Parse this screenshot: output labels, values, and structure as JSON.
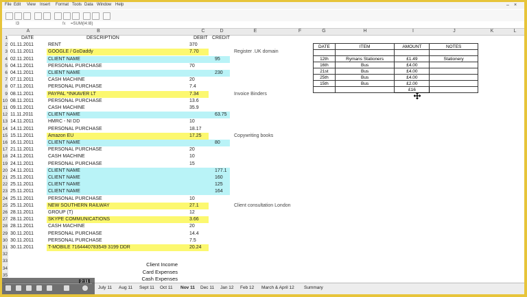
{
  "menu": [
    "File",
    "Edit",
    "View",
    "Insert",
    "Format",
    "Tools",
    "Data",
    "Window",
    "Help"
  ],
  "formula": {
    "namebox": "I3",
    "content": "=SUM(I4:I8)"
  },
  "columns": [
    "A",
    "B",
    "C",
    "D",
    "E",
    "F",
    "G",
    "H",
    "I",
    "J",
    "K",
    "L"
  ],
  "headers": {
    "date": "DATE",
    "desc": "DESCRIPTION",
    "debit": "DEBIT",
    "credit": "CREDIT"
  },
  "rows": [
    {
      "n": "2",
      "date": "01.11.2011",
      "desc": "RENT",
      "debit": "370",
      "credit": "",
      "hl": ""
    },
    {
      "n": "3",
      "date": "01.11.2011",
      "desc": "GOOGLE / GoDaddy",
      "debit": "7.70",
      "credit": "",
      "hl": "yel",
      "note": "Register .UK domain"
    },
    {
      "n": "4",
      "date": "02.11.2011",
      "desc": "CLIENT NAME",
      "debit": "",
      "credit": "95",
      "hl": "cyn"
    },
    {
      "n": "5",
      "date": "04.11.2011",
      "desc": "PERSONAL PURCHASE",
      "debit": "70",
      "credit": "",
      "hl": ""
    },
    {
      "n": "6",
      "date": "04.11.2011",
      "desc": "CLIENT NAME",
      "debit": "",
      "credit": "230",
      "hl": "cyn"
    },
    {
      "n": "7",
      "date": "07.11.2011",
      "desc": "CASH MACHINE",
      "debit": "20",
      "credit": "",
      "hl": ""
    },
    {
      "n": "8",
      "date": "07.11.2011",
      "desc": "PERSONAL PURCHASE",
      "debit": "7.4",
      "credit": "",
      "hl": ""
    },
    {
      "n": "9",
      "date": "08.11.2011",
      "desc": "PAYPAL *INKAVER LT",
      "debit": "7.34",
      "credit": "",
      "hl": "yel",
      "note": "Invoice Binders"
    },
    {
      "n": "10",
      "date": "08.11.2011",
      "desc": "PERSONAL PURCHASE",
      "debit": "13.6",
      "credit": "",
      "hl": ""
    },
    {
      "n": "11",
      "date": "09.11.2011",
      "desc": "CASH MACHINE",
      "debit": "35.9",
      "credit": "",
      "hl": ""
    },
    {
      "n": "12",
      "date": "11.11.2011",
      "desc": "CLIENT NAME",
      "debit": "",
      "credit": "63.75",
      "hl": "cyn"
    },
    {
      "n": "13",
      "date": "14.11.2011",
      "desc": "HMRC - NI DD",
      "debit": "10",
      "credit": "",
      "hl": ""
    },
    {
      "n": "14",
      "date": "14.11.2011",
      "desc": "PERSONAL PURCHASE",
      "debit": "18.17",
      "credit": "",
      "hl": ""
    },
    {
      "n": "15",
      "date": "15.11.2011",
      "desc": "Amazon EU",
      "debit": "17.25",
      "credit": "",
      "hl": "yel",
      "note": "Copywriting books"
    },
    {
      "n": "16",
      "date": "16.11.2011",
      "desc": "CLIENT NAME",
      "debit": "",
      "credit": "80",
      "hl": "cyn"
    },
    {
      "n": "17",
      "date": "21.11.2011",
      "desc": "PERSONAL PURCHASE",
      "debit": "20",
      "credit": "",
      "hl": ""
    },
    {
      "n": "18",
      "date": "24.11.2011",
      "desc": "CASH MACHINE",
      "debit": "10",
      "credit": "",
      "hl": ""
    },
    {
      "n": "19",
      "date": "24.11.2011",
      "desc": "PERSONAL PURCHASE",
      "debit": "15",
      "credit": "",
      "hl": ""
    },
    {
      "n": "20",
      "date": "24.11.2011",
      "desc": "CLIENT NAME",
      "debit": "",
      "credit": "177.1",
      "hl": "cyn"
    },
    {
      "n": "21",
      "date": "25.11.2011",
      "desc": "CLIENT NAME",
      "debit": "",
      "credit": "160",
      "hl": "cyn"
    },
    {
      "n": "22",
      "date": "25.11.2011",
      "desc": "CLIENT NAME",
      "debit": "",
      "credit": "125",
      "hl": "cyn"
    },
    {
      "n": "23",
      "date": "25.11.2011",
      "desc": "CLIENT NAME",
      "debit": "",
      "credit": "164",
      "hl": "cyn"
    },
    {
      "n": "24",
      "date": "25.11.2011",
      "desc": "PERSONAL PURCHASE",
      "debit": "10",
      "credit": "",
      "hl": ""
    },
    {
      "n": "25",
      "date": "25.11.2011",
      "desc": "NEW SOUTHERN RAILWAY",
      "debit": "27.1",
      "credit": "",
      "hl": "yel",
      "note": "Client consultation London"
    },
    {
      "n": "26",
      "date": "28.11.2011",
      "desc": "GROUP (T)",
      "debit": "12",
      "credit": "",
      "hl": ""
    },
    {
      "n": "27",
      "date": "28.11.2011",
      "desc": "SKYPE COMMUNICATIONS",
      "debit": "3.66",
      "credit": "",
      "hl": "yel"
    },
    {
      "n": "28",
      "date": "28.11.2011",
      "desc": "CASH MACHINE",
      "debit": "20",
      "credit": "",
      "hl": ""
    },
    {
      "n": "29",
      "date": "30.11.2011",
      "desc": "PERSONAL PURCHASE",
      "debit": "14.4",
      "credit": "",
      "hl": ""
    },
    {
      "n": "30",
      "date": "30.11.2011",
      "desc": "PERSONAL PURCHASE",
      "debit": "7.5",
      "credit": "",
      "hl": ""
    },
    {
      "n": "31",
      "date": "30.11.2011",
      "desc": "T-MOBILE      7164440783549 3199 DDR",
      "debit": "20.24",
      "credit": "",
      "hl": "yel"
    },
    {
      "n": "32",
      "date": "",
      "desc": "",
      "debit": "",
      "credit": "",
      "hl": ""
    },
    {
      "n": "33",
      "date": "",
      "desc": "",
      "debit": "",
      "credit": "",
      "hl": ""
    },
    {
      "n": "34",
      "date": "",
      "desc": "",
      "debit": "",
      "credit": "",
      "hl": ""
    },
    {
      "n": "35",
      "date": "",
      "desc": "",
      "debit": "",
      "credit": "",
      "hl": ""
    }
  ],
  "lookup": {
    "headers": [
      "DATE",
      "ITEM",
      "AMOUNT",
      "NOTES"
    ],
    "rows": [
      [
        "",
        "",
        "",
        ""
      ],
      [
        "12th",
        "Rymans Stationers",
        "£1.49",
        "Stationery"
      ],
      [
        "16th",
        "Bus",
        "£4.00",
        ""
      ],
      [
        "21st",
        "Bus",
        "£4.00",
        ""
      ],
      [
        "25th",
        "Bus",
        "£4.00",
        ""
      ],
      [
        "15th",
        "Bus",
        "£2.00",
        ""
      ],
      [
        "",
        "",
        "£16",
        ""
      ]
    ]
  },
  "summary": [
    "Client Income",
    "Card Expenses",
    "Cash Expenses"
  ],
  "tabs": [
    "July 11",
    "Aug 11",
    "Sept 11",
    "Oct 11",
    "Nov 11",
    "Dec 11",
    "Jan 12",
    "Feb 12",
    "March & April 12",
    "Summary"
  ],
  "active_tab": "Nov 11",
  "video_time": "2:11",
  "colors": {
    "yellow": "#fcf86f",
    "cyan": "#b9f3f7",
    "frame": "#e7c43a"
  }
}
